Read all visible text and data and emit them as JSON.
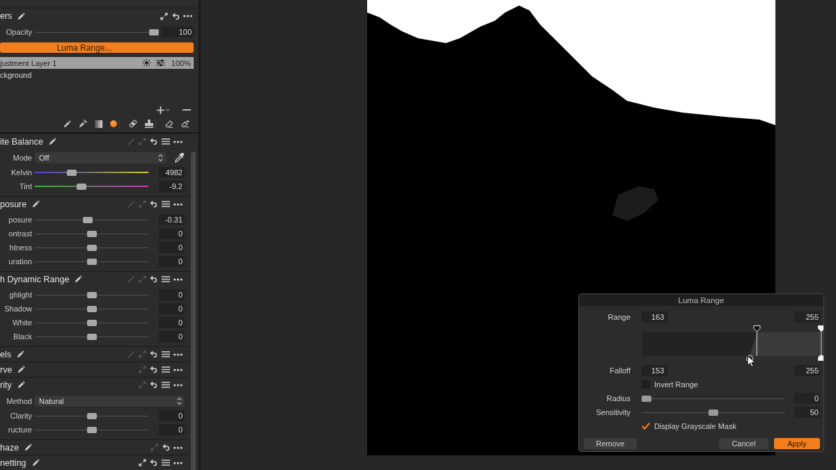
{
  "layers": {
    "title": "ers",
    "tools": [
      {
        "kind": "copy",
        "disabled": false
      },
      {
        "kind": "reset",
        "disabled": false
      },
      {
        "kind": "more",
        "disabled": false
      }
    ],
    "opacity": {
      "label": "Opacity",
      "level": 1,
      "value": "100"
    },
    "mask_button": "Luma Range...",
    "items": [
      {
        "kind": "adjustment",
        "name": "justment Layer 1",
        "opacity": "100%",
        "selected": true
      },
      {
        "kind": "background",
        "name": "ckground",
        "selected": false
      }
    ],
    "mask_tools": [
      {
        "kind": "brush"
      },
      {
        "kind": "magicbrush"
      },
      {
        "kind": "gradient"
      },
      {
        "kind": "dot"
      },
      {
        "kind": "separator"
      },
      {
        "kind": "bandage"
      },
      {
        "kind": "stamp"
      },
      {
        "kind": "separator"
      },
      {
        "kind": "eraser"
      },
      {
        "kind": "magiceraser"
      }
    ]
  },
  "adjustments": [
    {
      "title": "ite Balance",
      "tools": [
        {
          "kind": "auto",
          "disabled": true
        },
        {
          "kind": "copy",
          "disabled": true
        },
        {
          "kind": "reset",
          "disabled": false
        },
        {
          "kind": "presets",
          "disabled": false
        },
        {
          "kind": "more",
          "disabled": false
        }
      ],
      "rows": [
        {
          "kind": "dropdown",
          "label": "Mode",
          "value": "Off",
          "picker": true
        },
        {
          "kind": "temperature",
          "label": "Kelvin",
          "level": 0.31,
          "value": "4982"
        },
        {
          "kind": "tint",
          "label": "Tint",
          "level": 0.4,
          "value": "-9.2"
        }
      ]
    },
    {
      "title": "posure",
      "tools": [
        {
          "kind": "auto",
          "disabled": true
        },
        {
          "kind": "copy",
          "disabled": true
        },
        {
          "kind": "reset",
          "disabled": false
        },
        {
          "kind": "presets",
          "disabled": false
        },
        {
          "kind": "more",
          "disabled": false
        }
      ],
      "rows": [
        {
          "kind": "slider",
          "label": "posure",
          "level": 0.46,
          "value": "-0.31"
        },
        {
          "kind": "slider",
          "label": "ontrast",
          "level": 0.5,
          "value": "0"
        },
        {
          "kind": "slider",
          "label": "htness",
          "level": 0.5,
          "value": "0"
        },
        {
          "kind": "slider",
          "label": "uration",
          "level": 0.5,
          "value": "0"
        }
      ]
    },
    {
      "title": "h Dynamic Range",
      "tools": [
        {
          "kind": "auto",
          "disabled": true
        },
        {
          "kind": "copy",
          "disabled": true
        },
        {
          "kind": "reset",
          "disabled": false
        },
        {
          "kind": "presets",
          "disabled": false
        },
        {
          "kind": "more",
          "disabled": false
        }
      ],
      "rows": [
        {
          "kind": "slider",
          "label": "ghlight",
          "level": 0.5,
          "value": "0"
        },
        {
          "kind": "slider",
          "label": "Shadow",
          "level": 0.5,
          "value": "0"
        },
        {
          "kind": "slider",
          "label": "White",
          "level": 0.5,
          "value": "0"
        },
        {
          "kind": "slider",
          "label": "Black",
          "level": 0.5,
          "value": "0"
        }
      ]
    },
    {
      "title": "els",
      "tools": [
        {
          "kind": "auto",
          "disabled": true
        },
        {
          "kind": "copy",
          "disabled": true
        },
        {
          "kind": "reset",
          "disabled": false
        },
        {
          "kind": "presets",
          "disabled": false
        },
        {
          "kind": "more",
          "disabled": false
        }
      ]
    },
    {
      "title": "rve",
      "tools": [
        {
          "kind": "copy",
          "disabled": true
        },
        {
          "kind": "reset",
          "disabled": false
        },
        {
          "kind": "presets",
          "disabled": false
        },
        {
          "kind": "more",
          "disabled": false
        }
      ]
    },
    {
      "title": "rity",
      "tools": [
        {
          "kind": "copy",
          "disabled": true
        },
        {
          "kind": "reset",
          "disabled": false
        },
        {
          "kind": "presets",
          "disabled": false
        },
        {
          "kind": "more",
          "disabled": false
        }
      ],
      "rows": [
        {
          "kind": "dropdown",
          "label": "Method",
          "value": "Natural",
          "picker": false
        },
        {
          "kind": "slider",
          "label": "Clarity",
          "level": 0.5,
          "value": "0"
        },
        {
          "kind": "slider",
          "label": "ructure",
          "level": 0.5,
          "value": "0"
        }
      ]
    },
    {
      "title": "haze",
      "tools": [
        {
          "kind": "copy",
          "disabled": true
        },
        {
          "kind": "reset",
          "disabled": false
        },
        {
          "kind": "more",
          "disabled": false
        }
      ]
    },
    {
      "title": "netting",
      "tools": [
        {
          "kind": "copy",
          "disabled": false
        },
        {
          "kind": "reset",
          "disabled": false
        },
        {
          "kind": "presets",
          "disabled": false
        },
        {
          "kind": "more",
          "disabled": false
        }
      ]
    }
  ],
  "dialog": {
    "title": "Luma Range",
    "range": {
      "label": "Range",
      "low": "163",
      "high": "255"
    },
    "graph": {
      "range_handles": [
        {
          "level": 0.64
        },
        {
          "level": 1
        }
      ],
      "falloff_handles": [
        {
          "level": 0.6
        },
        {
          "level": 1
        }
      ]
    },
    "falloff": {
      "label": "Falloff",
      "low": "153",
      "high": "255"
    },
    "invert": {
      "label": "Invert Range",
      "checked": false
    },
    "sliders": [
      {
        "label": "Radius",
        "level": 0,
        "value": "0"
      },
      {
        "label": "Sensitivity",
        "level": 0.5,
        "value": "50"
      }
    ],
    "grayscale": {
      "label": "Display Grayscale Mask",
      "checked": true
    },
    "buttons": [
      {
        "label": "Remove",
        "kind": "plain"
      },
      {
        "label": "Cancel",
        "kind": "plain"
      },
      {
        "label": "Apply",
        "kind": "primary"
      }
    ]
  }
}
